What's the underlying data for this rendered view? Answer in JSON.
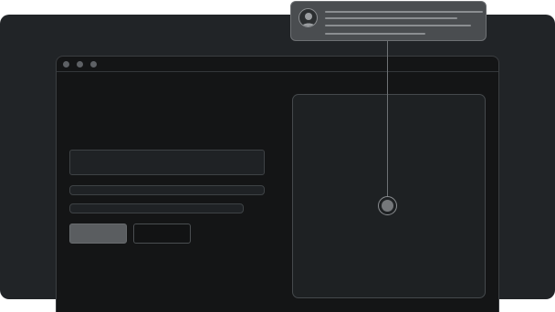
{
  "colors": {
    "backdrop": "#212427",
    "window_bg": "#141516",
    "panel_bg": "#1e2123",
    "comment_card_bg": "#4a4d50",
    "primary_button": "#5a5d60",
    "connector": "#6e7275"
  },
  "window": {
    "controls": [
      "close-dot",
      "minimize-dot",
      "maximize-dot"
    ]
  },
  "icons": {
    "avatar": "user-avatar-icon"
  }
}
